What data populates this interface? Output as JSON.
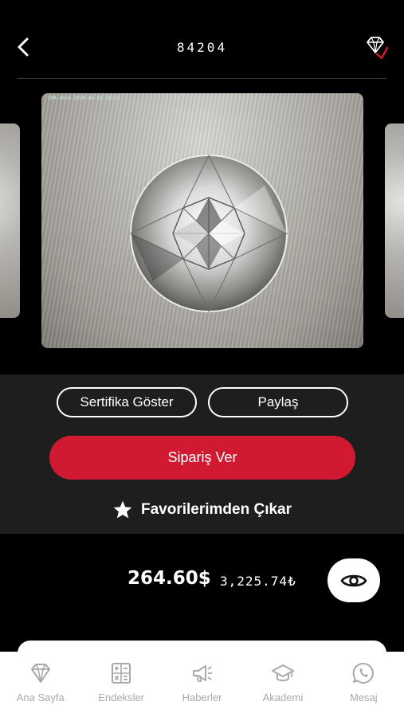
{
  "header": {
    "title": "84204"
  },
  "gallery": {
    "camera_overlay": "CMA-4024  2020-04-29 10:52"
  },
  "actions": {
    "certificate_label": "Sertifika Göster",
    "share_label": "Paylaş",
    "order_label": "Sipariş Ver",
    "favorite_label": "Favorilerimden Çıkar"
  },
  "price": {
    "usd": "264.60$",
    "try": "3,225.74₺"
  },
  "tabbar": {
    "items": [
      {
        "label": "Ana Sayfa",
        "icon": "diamond-icon"
      },
      {
        "label": "Endeksler",
        "icon": "calculator-icon"
      },
      {
        "label": "Haberler",
        "icon": "megaphone-icon"
      },
      {
        "label": "Akademi",
        "icon": "graduation-cap-icon"
      },
      {
        "label": "Mesaj",
        "icon": "whatsapp-icon"
      }
    ]
  },
  "colors": {
    "accent": "#d11a32",
    "background": "#000000",
    "panel": "#1e1e1e",
    "tab_inactive": "#a9a9a9"
  }
}
